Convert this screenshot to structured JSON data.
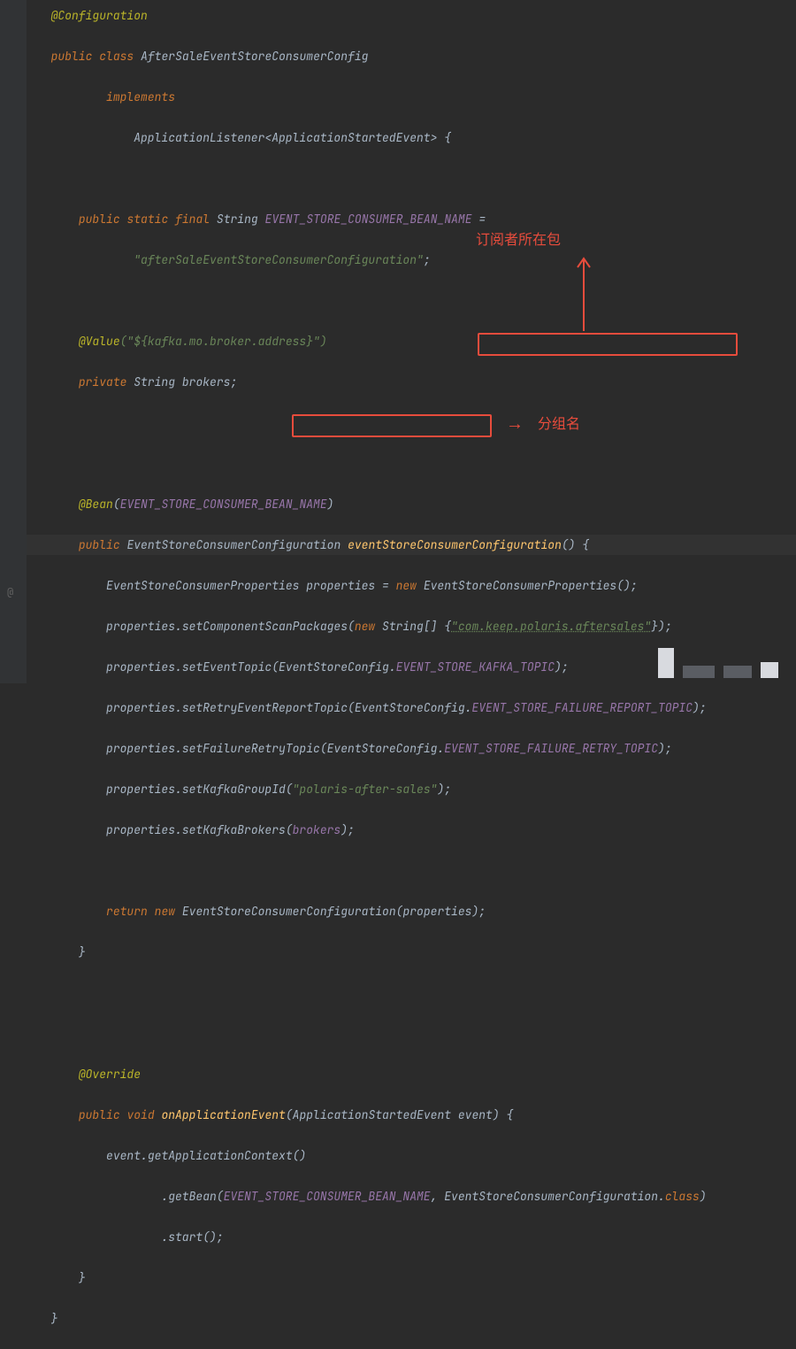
{
  "colors": {
    "bg": "#2b2b2b",
    "keyword": "#cc7832",
    "annotation": "#bbb529",
    "string": "#6a8759",
    "field": "#9876aa",
    "method": "#ffc66d",
    "callout": "#e74c3c"
  },
  "gutter": {
    "at_marker": "@"
  },
  "callouts": {
    "package_label": "订阅者所在包",
    "group_label": "分组名",
    "arrow_right": "→"
  },
  "code": {
    "l01_ann": "@Configuration",
    "l02_kw1": "public",
    "l02_kw2": "class",
    "l02_name": "AfterSaleEventStoreConsumerConfig",
    "l03_kw": "implements",
    "l04_text": "ApplicationListener<ApplicationStartedEvent> {",
    "l06_kw1": "public",
    "l06_kw2": "static",
    "l06_kw3": "final",
    "l06_type": "String",
    "l06_const": "EVENT_STORE_CONSUMER_BEAN_NAME",
    "l06_eq": " =",
    "l07_str": "\"afterSaleEventStoreConsumerConfiguration\"",
    "l07_end": ";",
    "l09_ann": "@Value",
    "l09_str": "(\"${kafka.mo.broker.address}\")",
    "l10_kw": "private",
    "l10_type": "String",
    "l10_name": "brokers;",
    "l13_ann": "@Bean",
    "l13_arg": "EVENT_STORE_CONSUMER_BEAN_NAME",
    "l14_kw": "public",
    "l14_type": "EventStoreConsumerConfiguration",
    "l14_mth": "eventStoreConsumerConfiguration",
    "l14_end": "() {",
    "l15_a": "EventStoreConsumerProperties properties = ",
    "l15_new": "new",
    "l15_b": " EventStoreConsumerProperties();",
    "l16_a": "properties.setComponentScanPackages(",
    "l16_new": "new",
    "l16_b": " String[] {",
    "l16_str": "\"com.keep.polaris.aftersales\"",
    "l16_c": "});",
    "l17_a": "properties.setEventTopic(EventStoreConfig.",
    "l17_const": "EVENT_STORE_KAFKA_TOPIC",
    "l17_b": ");",
    "l18_a": "properties.setRetryEventReportTopic(EventStoreConfig.",
    "l18_const": "EVENT_STORE_FAILURE_REPORT_TOPIC",
    "l18_b": ");",
    "l19_a": "properties.setFailureRetryTopic(EventStoreConfig.",
    "l19_const": "EVENT_STORE_FAILURE_RETRY_TOPIC",
    "l19_b": ");",
    "l20_a": "properties.setKafkaGroupId(",
    "l20_str": "\"polaris-after-sales\"",
    "l20_b": ");",
    "l21_a": "properties.setKafkaBrokers(",
    "l21_arg": "brokers",
    "l21_b": ");",
    "l23_kw": "return",
    "l23_new": "new",
    "l23_rest": " EventStoreConsumerConfiguration(properties);",
    "l24_brace": "}",
    "l27_ann": "@Override",
    "l28_kw1": "public",
    "l28_kw2": "void",
    "l28_mth": "onApplicationEvent",
    "l28_rest": "(ApplicationStartedEvent event) {",
    "l29_a": "event.getApplicationContext()",
    "l30_a": ".getBean(",
    "l30_const": "EVENT_STORE_CONSUMER_BEAN_NAME",
    "l30_b": ", EventStoreConsumerConfiguration.",
    "l30_kw": "class",
    "l30_c": ")",
    "l31_a": ".start();",
    "l32_brace": "}",
    "l33_brace": "}"
  }
}
